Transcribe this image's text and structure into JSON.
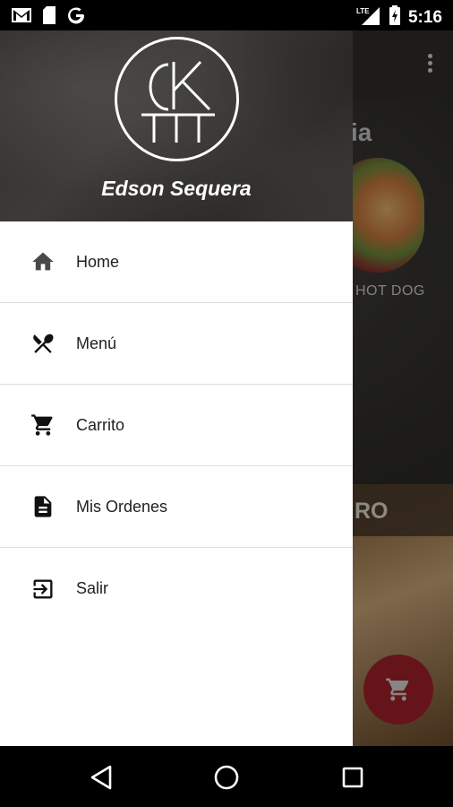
{
  "status_bar": {
    "time": "5:16",
    "network": "LTE",
    "icons": [
      "gmail-icon",
      "sd-card-icon",
      "google-icon",
      "signal-icon",
      "battery-charging-icon"
    ]
  },
  "background_app": {
    "partial_title": "ia",
    "item_label": "HOT DOG",
    "section_partial": "RO",
    "fab_icon": "cart-icon",
    "accent_color": "#a3232b"
  },
  "drawer": {
    "user_name": "Edson Sequera",
    "logo_text": "CK",
    "items": [
      {
        "label": "Home",
        "icon": "home-icon"
      },
      {
        "label": "Menú",
        "icon": "utensils-icon"
      },
      {
        "label": "Carrito",
        "icon": "cart-icon"
      },
      {
        "label": "Mis Ordenes",
        "icon": "document-icon"
      },
      {
        "label": "Salir",
        "icon": "exit-icon"
      }
    ]
  },
  "nav_bar": {
    "buttons": [
      "back-icon",
      "home-circle-icon",
      "recents-icon"
    ]
  }
}
